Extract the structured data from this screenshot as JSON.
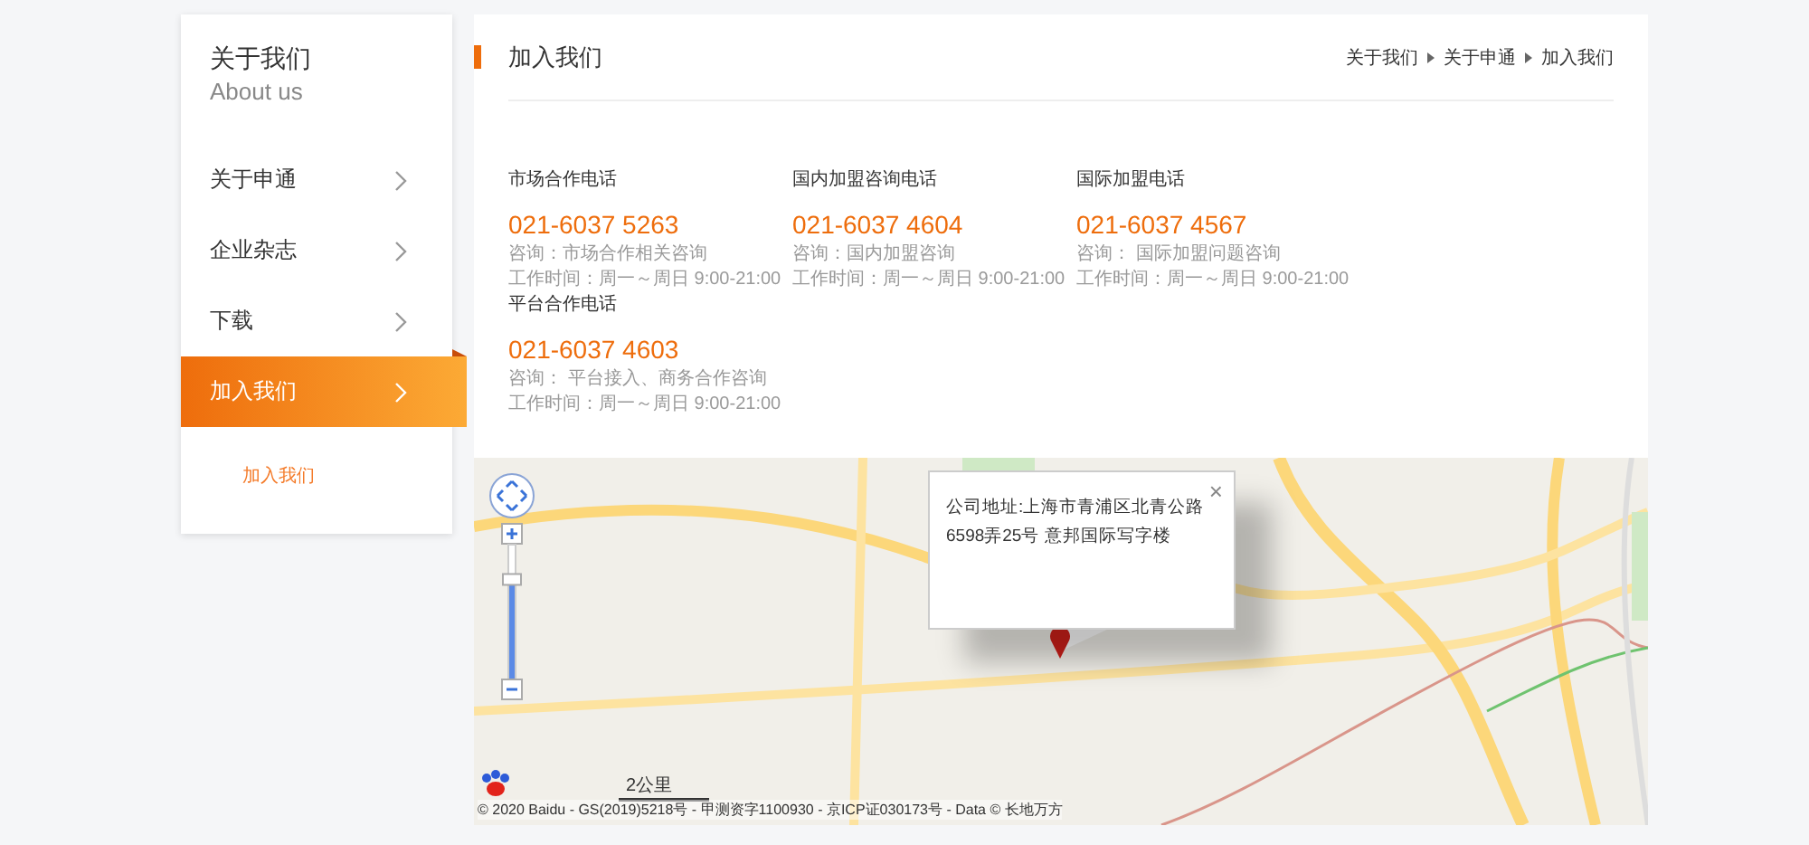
{
  "sidebar": {
    "title": "关于我们",
    "subtitle": "About us",
    "items": [
      {
        "label": "关于申通",
        "selected": false
      },
      {
        "label": "企业杂志",
        "selected": false
      },
      {
        "label": "下载",
        "selected": false
      },
      {
        "label": "加入我们",
        "selected": true
      }
    ],
    "subitems": [
      {
        "label": "加入我们"
      }
    ]
  },
  "main": {
    "title": "加入我们",
    "breadcrumb": [
      "关于我们",
      "关于申通",
      "加入我们"
    ],
    "contacts": [
      {
        "heading": "市场合作电话",
        "phone": "021-6037 5263",
        "consult": "咨询：市场合作相关咨询",
        "hours": "工作时间：周一～周日 9:00-21:00"
      },
      {
        "heading": "国内加盟咨询电话",
        "phone": "021-6037 4604",
        "consult": "咨询：国内加盟咨询",
        "hours": "工作时间：周一～周日 9:00-21:00"
      },
      {
        "heading": "国际加盟电话",
        "phone": "021-6037 4567",
        "consult": "咨询： 国际加盟问题咨询",
        "hours": "工作时间：周一～周日 9:00-21:00"
      },
      {
        "heading": "平台合作电话",
        "phone": "021-6037 4603",
        "consult": "咨询： 平台接入、商务合作咨询",
        "hours": "工作时间：周一～周日 9:00-21:00"
      }
    ]
  },
  "map": {
    "zoom": {
      "level": 0.74
    },
    "info_window": {
      "text": "公司地址:上海市青浦区北青公路6598弄25号 意邦国际写字楼",
      "close": "×"
    },
    "scale": "2公里",
    "copyright": "© 2020 Baidu - GS(2019)5218号 - 甲测资字1100930 - 京ICP证030173号 - Data © 长地万方"
  }
}
